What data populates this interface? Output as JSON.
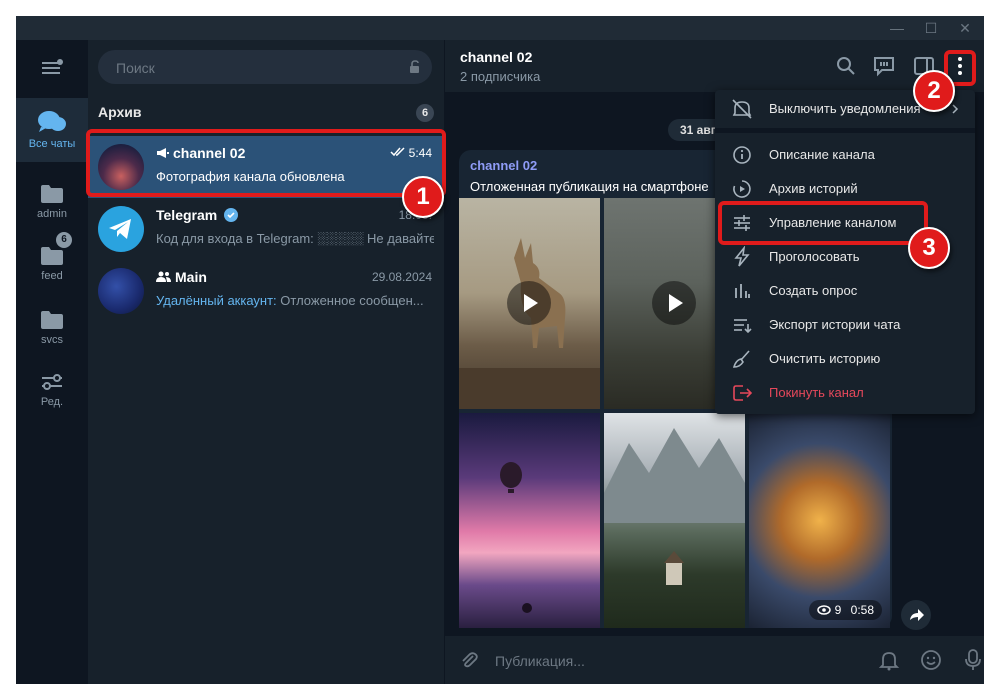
{
  "window": {
    "minimize": "—",
    "maximize": "☐",
    "close": "✕"
  },
  "folders": [
    {
      "label": "Все чаты",
      "icon": "chats-icon",
      "active": true
    },
    {
      "label": "admin",
      "icon": "folder-icon"
    },
    {
      "label": "feed",
      "icon": "folder-icon",
      "badge": "6"
    },
    {
      "label": "svcs",
      "icon": "folder-icon"
    },
    {
      "label": "Ред.",
      "icon": "edit-folders-icon"
    }
  ],
  "search": {
    "placeholder": "Поиск"
  },
  "archive": {
    "title": "Архив",
    "count": "6"
  },
  "chats": [
    {
      "title": "channel 02",
      "time": "5:44",
      "preview": "Фотография канала обновлена",
      "selected": true
    },
    {
      "title": "Telegram",
      "time": "18.09.",
      "preview": "Код для входа в Telegram: ░░░░░ Не давайте"
    },
    {
      "title": "Main",
      "time": "29.08.2024",
      "preview_author": "Удалённый аккаунт:",
      "preview": " Отложенное сообщен..."
    }
  ],
  "header": {
    "title": "channel 02",
    "subtitle": "2 подписчика"
  },
  "date_chip": "31 авг",
  "post": {
    "author": "channel 02",
    "text": "Отложенная публикация на смартфоне",
    "views": "9",
    "time": "0:58"
  },
  "composer": {
    "placeholder": "Публикация..."
  },
  "menu": {
    "items": [
      {
        "label": "Выключить уведомления",
        "icon": "mute-icon"
      },
      {
        "label": "Описание канала",
        "icon": "info-icon"
      },
      {
        "label": "Архив историй",
        "icon": "stories-archive-icon"
      },
      {
        "label": "Управление каналом",
        "icon": "manage-channel-icon"
      },
      {
        "label": "Проголосовать",
        "icon": "boost-icon"
      },
      {
        "label": "Создать опрос",
        "icon": "poll-icon"
      },
      {
        "label": "Экспорт истории чата",
        "icon": "export-icon"
      },
      {
        "label": "Очистить историю",
        "icon": "clear-history-icon"
      },
      {
        "label": "Покинуть канал",
        "icon": "leave-icon",
        "danger": true
      }
    ]
  },
  "markers": [
    "1",
    "2",
    "3"
  ],
  "colors": {
    "accent": "#64b5ef",
    "selected": "#2b5278",
    "highlight": "#e01b1b",
    "danger": "#e5485b"
  }
}
